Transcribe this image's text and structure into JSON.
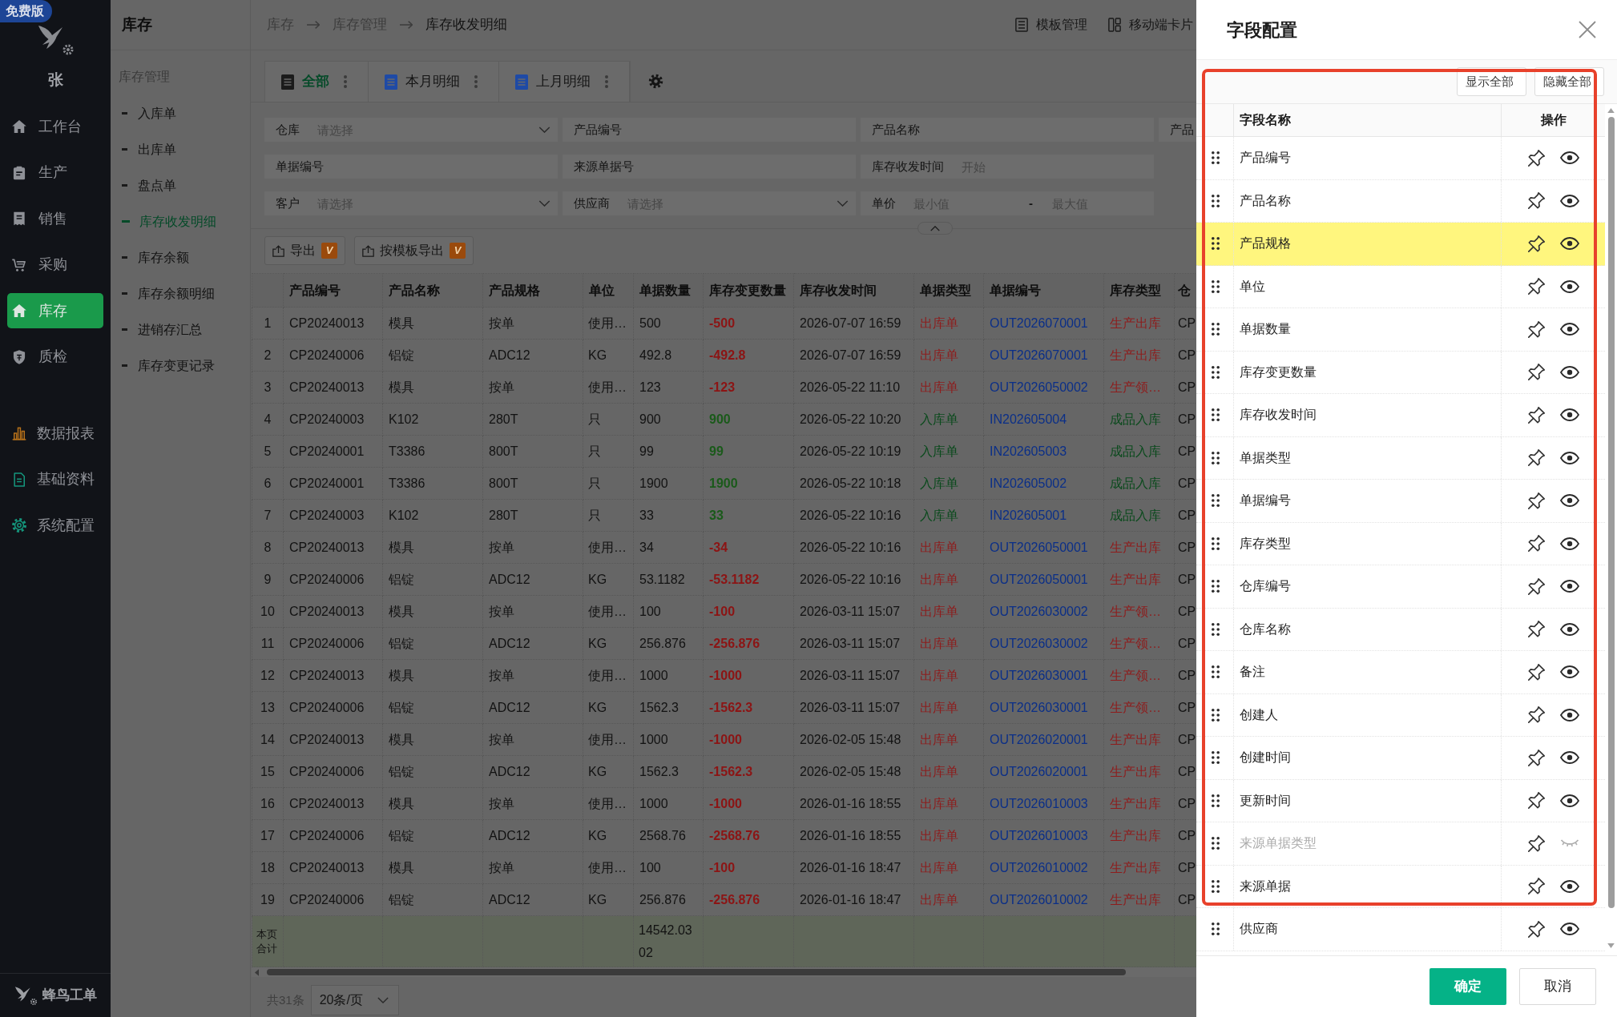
{
  "badge": "免费版",
  "sidebar": {
    "user": "张",
    "items": [
      {
        "label": "工作台",
        "selected": false
      },
      {
        "label": "生产",
        "selected": false
      },
      {
        "label": "销售",
        "selected": false
      },
      {
        "label": "采购",
        "selected": false
      },
      {
        "label": "库存",
        "selected": true
      },
      {
        "label": "质检",
        "selected": false
      }
    ],
    "extra_items": [
      {
        "label": "数据报表",
        "selected": false
      },
      {
        "label": "基础资料",
        "selected": false
      },
      {
        "label": "系统配置",
        "selected": false
      }
    ],
    "brand": "蜂鸟工单"
  },
  "submenu": {
    "title": "库存",
    "group": "库存管理",
    "items": [
      {
        "label": "入库单",
        "selected": false
      },
      {
        "label": "出库单",
        "selected": false
      },
      {
        "label": "盘点单",
        "selected": false
      },
      {
        "label": "库存收发明细",
        "selected": true
      },
      {
        "label": "库存余额",
        "selected": false
      },
      {
        "label": "库存余额明细",
        "selected": false
      },
      {
        "label": "进销存汇总",
        "selected": false
      },
      {
        "label": "库存变更记录",
        "selected": false
      }
    ]
  },
  "breadcrumb": [
    "库存",
    "库存管理",
    "库存收发明细"
  ],
  "header_actions": [
    "模板管理",
    "移动端卡片"
  ],
  "view_tabs": [
    {
      "label": "全部",
      "selected": true
    },
    {
      "label": "本月明细",
      "selected": false
    },
    {
      "label": "上月明细",
      "selected": false
    }
  ],
  "filters": [
    [
      {
        "kind": "select",
        "label": "仓库",
        "placeholder": "请选择"
      },
      {
        "kind": "text",
        "label": "产品编号"
      },
      {
        "kind": "text",
        "label": "产品名称"
      },
      {
        "kind": "cut",
        "label": "产品"
      }
    ],
    [
      {
        "kind": "text",
        "label": "单据编号"
      },
      {
        "kind": "text",
        "label": "来源单据号"
      },
      {
        "kind": "text",
        "label": "库存收发时间",
        "placeholder": "开始"
      }
    ],
    [
      {
        "kind": "select",
        "label": "客户",
        "placeholder": "请选择"
      },
      {
        "kind": "select",
        "label": "供应商",
        "placeholder": "请选择"
      },
      {
        "kind": "range",
        "label": "单价",
        "placeholder": "最小值",
        "separator": "-",
        "placeholder_end": "最大值"
      }
    ]
  ],
  "filter_toggle": {
    "expanded": true
  },
  "export_buttons": [
    {
      "label": "导出",
      "badge": "V"
    },
    {
      "label": "按模板导出",
      "badge": "V"
    }
  ],
  "table": {
    "columns": [
      "产品编号",
      "产品名称",
      "产品规格",
      "单位",
      "单据数量",
      "库存变更数量",
      "库存收发时间",
      "单据类型",
      "单据编号",
      "库存类型",
      "仓"
    ],
    "rows": [
      {
        "index": "1",
        "kind": "out",
        "cells": [
          "CP20240013",
          "模具",
          "按单",
          "使用…",
          "500",
          "-500",
          "2026-07-07 16:59",
          "出库单",
          "OUT2026070001",
          "生产出库",
          "CP"
        ]
      },
      {
        "index": "2",
        "kind": "out",
        "cells": [
          "CP20240006",
          "铝锭",
          "ADC12",
          "KG",
          "492.8",
          "-492.8",
          "2026-07-07 16:59",
          "出库单",
          "OUT2026070001",
          "生产出库",
          "CP"
        ]
      },
      {
        "index": "3",
        "kind": "out",
        "cells": [
          "CP20240013",
          "模具",
          "按单",
          "使用…",
          "123",
          "-123",
          "2026-05-22 11:10",
          "出库单",
          "OUT2026050002",
          "生产领…",
          "CP"
        ]
      },
      {
        "index": "4",
        "kind": "in",
        "cells": [
          "CP20240003",
          "K102",
          "280T",
          "只",
          "900",
          "900",
          "2026-05-22 10:20",
          "入库单",
          "IN202605004",
          "成品入库",
          "CP"
        ]
      },
      {
        "index": "5",
        "kind": "in",
        "cells": [
          "CP20240001",
          "T3386",
          "800T",
          "只",
          "99",
          "99",
          "2026-05-22 10:19",
          "入库单",
          "IN202605003",
          "成品入库",
          "CP"
        ]
      },
      {
        "index": "6",
        "kind": "in",
        "cells": [
          "CP20240001",
          "T3386",
          "800T",
          "只",
          "1900",
          "1900",
          "2026-05-22 10:18",
          "入库单",
          "IN202605002",
          "成品入库",
          "CP"
        ]
      },
      {
        "index": "7",
        "kind": "in",
        "cells": [
          "CP20240003",
          "K102",
          "280T",
          "只",
          "33",
          "33",
          "2026-05-22 10:16",
          "入库单",
          "IN202605001",
          "成品入库",
          "CP"
        ]
      },
      {
        "index": "8",
        "kind": "out",
        "cells": [
          "CP20240013",
          "模具",
          "按单",
          "使用…",
          "34",
          "-34",
          "2026-05-22 10:16",
          "出库单",
          "OUT2026050001",
          "生产出库",
          "CP"
        ]
      },
      {
        "index": "9",
        "kind": "out",
        "cells": [
          "CP20240006",
          "铝锭",
          "ADC12",
          "KG",
          "53.1182",
          "-53.1182",
          "2026-05-22 10:16",
          "出库单",
          "OUT2026050001",
          "生产出库",
          "CP"
        ]
      },
      {
        "index": "10",
        "kind": "out",
        "cells": [
          "CP20240013",
          "模具",
          "按单",
          "使用…",
          "100",
          "-100",
          "2026-03-11 15:07",
          "出库单",
          "OUT2026030002",
          "生产领…",
          "CP"
        ]
      },
      {
        "index": "11",
        "kind": "out",
        "cells": [
          "CP20240006",
          "铝锭",
          "ADC12",
          "KG",
          "256.876",
          "-256.876",
          "2026-03-11 15:07",
          "出库单",
          "OUT2026030002",
          "生产领…",
          "CP"
        ]
      },
      {
        "index": "12",
        "kind": "out",
        "cells": [
          "CP20240013",
          "模具",
          "按单",
          "使用…",
          "1000",
          "-1000",
          "2026-03-11 15:07",
          "出库单",
          "OUT2026030001",
          "生产领…",
          "CP"
        ]
      },
      {
        "index": "13",
        "kind": "out",
        "cells": [
          "CP20240006",
          "铝锭",
          "ADC12",
          "KG",
          "1562.3",
          "-1562.3",
          "2026-03-11 15:07",
          "出库单",
          "OUT2026030001",
          "生产领…",
          "CP"
        ]
      },
      {
        "index": "14",
        "kind": "out",
        "cells": [
          "CP20240013",
          "模具",
          "按单",
          "使用…",
          "1000",
          "-1000",
          "2026-02-05 15:48",
          "出库单",
          "OUT2026020001",
          "生产出库",
          "CP"
        ]
      },
      {
        "index": "15",
        "kind": "out",
        "cells": [
          "CP20240006",
          "铝锭",
          "ADC12",
          "KG",
          "1562.3",
          "-1562.3",
          "2026-02-05 15:48",
          "出库单",
          "OUT2026020001",
          "生产出库",
          "CP"
        ]
      },
      {
        "index": "16",
        "kind": "out",
        "cells": [
          "CP20240013",
          "模具",
          "按单",
          "使用…",
          "1000",
          "-1000",
          "2026-01-16 18:55",
          "出库单",
          "OUT2026010003",
          "生产出库",
          "CP"
        ]
      },
      {
        "index": "17",
        "kind": "out",
        "cells": [
          "CP20240006",
          "铝锭",
          "ADC12",
          "KG",
          "2568.76",
          "-2568.76",
          "2026-01-16 18:55",
          "出库单",
          "OUT2026010003",
          "生产出库",
          "CP"
        ]
      },
      {
        "index": "18",
        "kind": "out",
        "cells": [
          "CP20240013",
          "模具",
          "按单",
          "使用…",
          "100",
          "-100",
          "2026-01-16 18:47",
          "出库单",
          "OUT2026010002",
          "生产出库",
          "CP"
        ]
      },
      {
        "index": "19",
        "kind": "out",
        "cells": [
          "CP20240006",
          "铝锭",
          "ADC12",
          "KG",
          "256.876",
          "-256.876",
          "2026-01-16 18:47",
          "出库单",
          "OUT2026010002",
          "生产出库",
          "CP"
        ]
      }
    ],
    "summary": {
      "label": "本页合计",
      "quantity_total": "14542.0302"
    }
  },
  "pagination": {
    "total": "共31条",
    "page_size": "20条/页"
  },
  "field_panel": {
    "title": "字段配置",
    "toolbar_buttons": [
      "显示全部",
      "隐藏全部"
    ],
    "columns": [
      "字段名称",
      "操作"
    ],
    "fields": [
      {
        "label": "产品编号",
        "visible": true,
        "selected": false
      },
      {
        "label": "产品名称",
        "visible": true,
        "selected": false
      },
      {
        "label": "产品规格",
        "visible": true,
        "selected": true
      },
      {
        "label": "单位",
        "visible": true,
        "selected": false
      },
      {
        "label": "单据数量",
        "visible": true,
        "selected": false
      },
      {
        "label": "库存变更数量",
        "visible": true,
        "selected": false
      },
      {
        "label": "库存收发时间",
        "visible": true,
        "selected": false
      },
      {
        "label": "单据类型",
        "visible": true,
        "selected": false
      },
      {
        "label": "单据编号",
        "visible": true,
        "selected": false
      },
      {
        "label": "库存类型",
        "visible": true,
        "selected": false
      },
      {
        "label": "仓库编号",
        "visible": true,
        "selected": false
      },
      {
        "label": "仓库名称",
        "visible": true,
        "selected": false
      },
      {
        "label": "备注",
        "visible": true,
        "selected": false
      },
      {
        "label": "创建人",
        "visible": true,
        "selected": false
      },
      {
        "label": "创建时间",
        "visible": true,
        "selected": false
      },
      {
        "label": "更新时间",
        "visible": true,
        "selected": false
      },
      {
        "label": "来源单据类型",
        "visible": false,
        "selected": false
      },
      {
        "label": "来源单据",
        "visible": true,
        "selected": false
      },
      {
        "label": "供应商",
        "visible": true,
        "selected": false
      }
    ],
    "buttons": [
      {
        "label": "确定",
        "kind": "primary"
      },
      {
        "label": "取消",
        "kind": "default"
      }
    ]
  },
  "annotation_frame": true
}
